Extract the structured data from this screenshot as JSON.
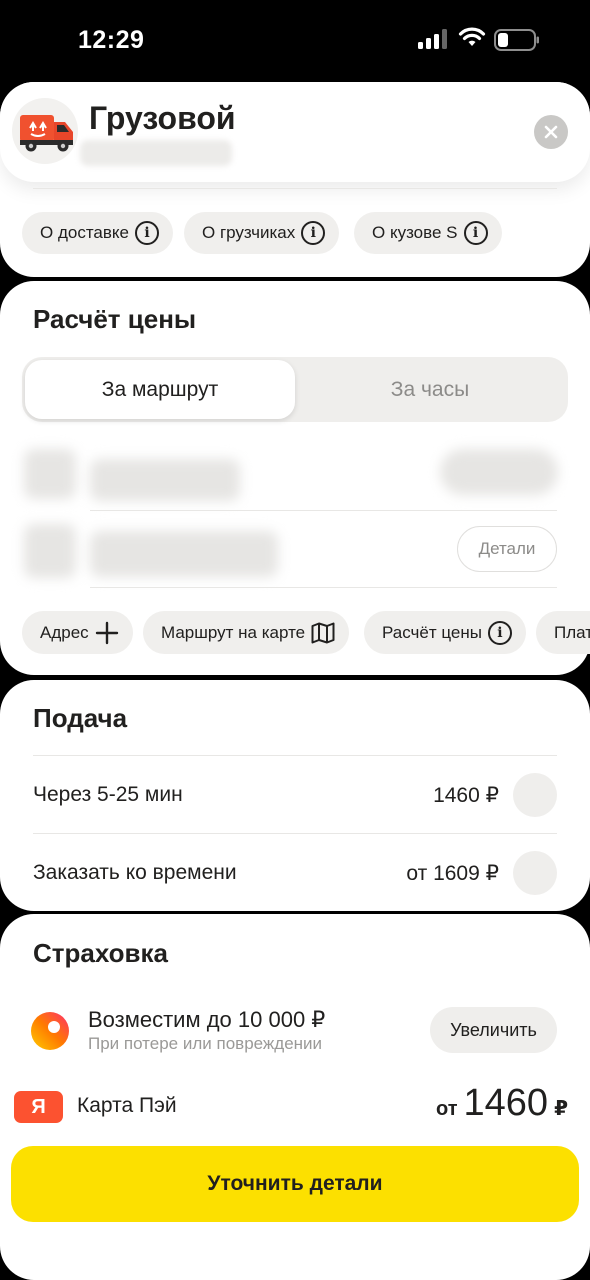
{
  "status_bar": {
    "time": "12:29",
    "icons": [
      "signal-icon",
      "wifi-icon",
      "battery-icon"
    ]
  },
  "header": {
    "title": "Грузовой",
    "info_chips": [
      {
        "label": "О доставке",
        "icon": "info-icon"
      },
      {
        "label": "О грузчиках",
        "icon": "info-icon"
      },
      {
        "label": "О кузове S",
        "icon": "info-icon"
      }
    ]
  },
  "price_calc": {
    "title": "Расчёт цены",
    "tabs": [
      {
        "label": "За маршрут",
        "active": true
      },
      {
        "label": "За часы",
        "active": false
      }
    ],
    "details_label": "Детали",
    "actions": [
      {
        "label": "Адрес",
        "icon": "plus-icon"
      },
      {
        "label": "Маршрут на карте",
        "icon": "map-icon"
      },
      {
        "label": "Расчёт цены",
        "icon": "info-icon"
      },
      {
        "label": "Плат",
        "icon": ""
      }
    ]
  },
  "supply": {
    "title": "Подача",
    "options": [
      {
        "label": "Через 5-25 мин",
        "price": "1460 ₽"
      },
      {
        "label": "Заказать ко времени",
        "price": "от 1609 ₽"
      }
    ]
  },
  "insurance": {
    "title": "Страховка",
    "headline": "Возместим до 10 000 ₽",
    "subtitle": "При потере или повреждении",
    "increase_label": "Увеличить"
  },
  "payment": {
    "badge": "Я",
    "method": "Карта Пэй"
  },
  "total": {
    "prefix": "от",
    "amount": "1460",
    "currency": "₽"
  },
  "cta_label": "Уточнить детали",
  "colors": {
    "accent_yellow": "#fce000",
    "pay_red": "#fc5230",
    "chip_bg": "#f0efed"
  }
}
